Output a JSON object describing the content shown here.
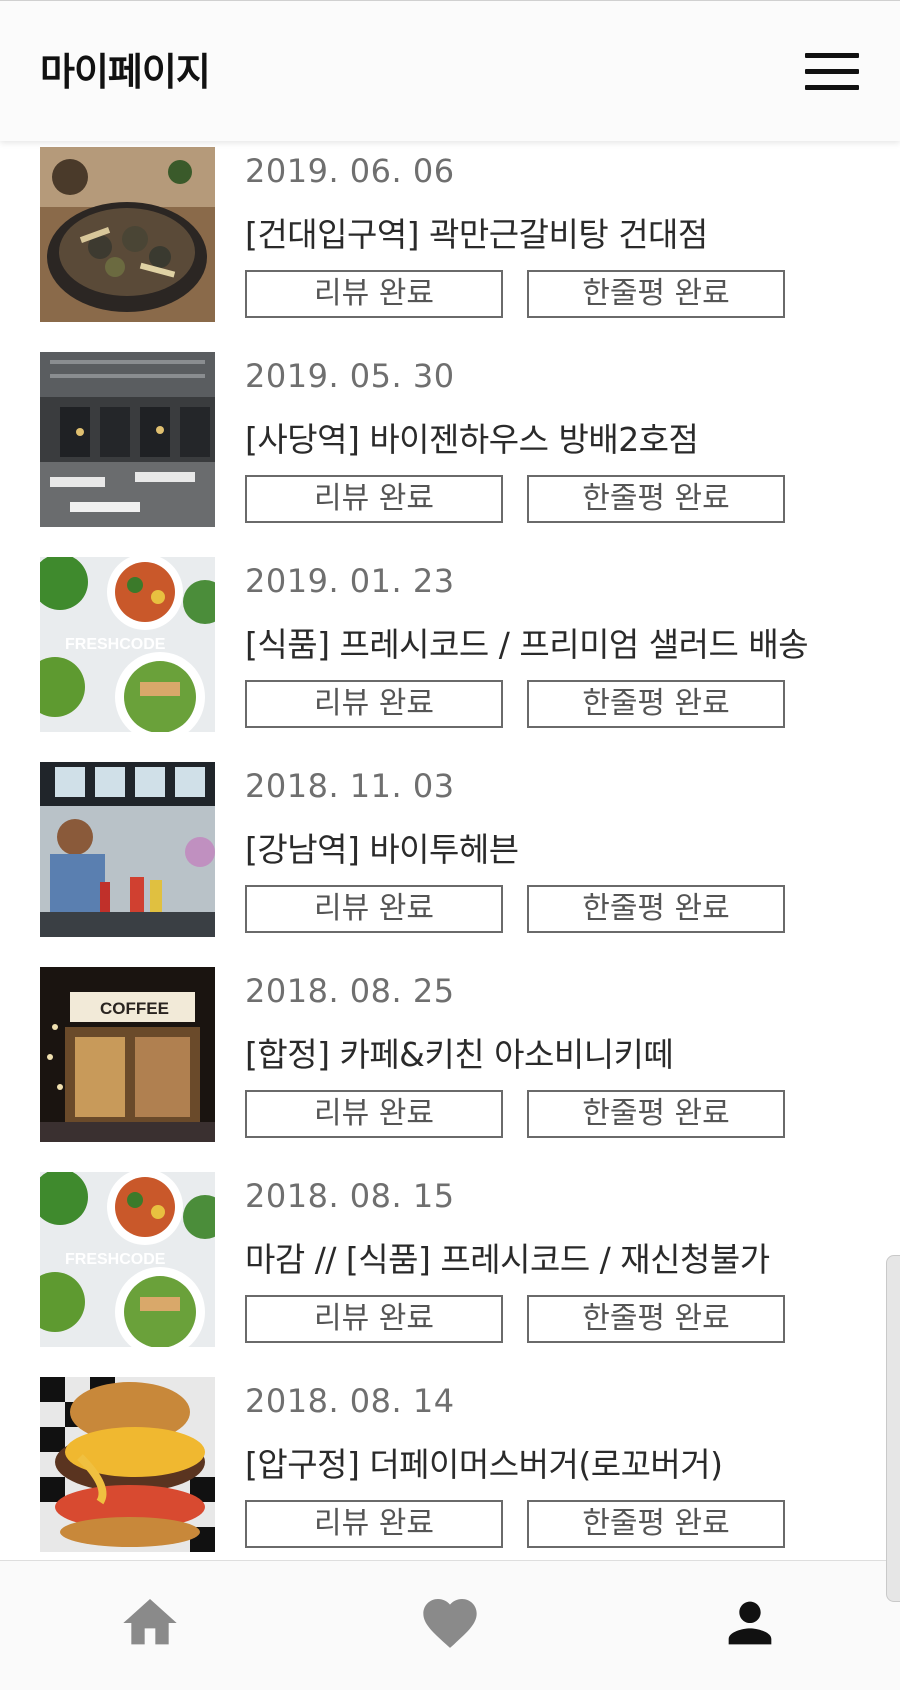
{
  "header": {
    "title": "마이페이지",
    "menu_icon": "hamburger-menu-icon"
  },
  "items": [
    {
      "date": "2019. 06. 06",
      "name": "[건대입구역] 곽만근갈비탕 건대점",
      "review_label": "리뷰 완료",
      "oneline_label": "한줄평 완료",
      "thumb": "food-galbi"
    },
    {
      "date": "2019. 05. 30",
      "name": "[사당역] 바이젠하우스 방배2호점",
      "review_label": "리뷰 완료",
      "oneline_label": "한줄평 완료",
      "thumb": "restaurant-interior"
    },
    {
      "date": "2019. 01. 23",
      "name": "[식품] 프레시코드 / 프리미엄 샐러드 배송",
      "review_label": "리뷰 완료",
      "oneline_label": "한줄평 완료",
      "thumb": "salad-freshcode",
      "thumb_text": "FRESHCODE"
    },
    {
      "date": "2018. 11. 03",
      "name": "[강남역] 바이투헤븐",
      "review_label": "리뷰 완료",
      "oneline_label": "한줄평 완료",
      "thumb": "mural-cafe"
    },
    {
      "date": "2018. 08. 25",
      "name": "[합정] 카페&키친 아소비니키떼",
      "review_label": "리뷰 완료",
      "oneline_label": "한줄평 완료",
      "thumb": "coffee-shop",
      "thumb_text": "COFFEE"
    },
    {
      "date": "2018. 08. 15",
      "name": "마감 // [식품] 프레시코드 / 재신청불가",
      "review_label": "리뷰 완료",
      "oneline_label": "한줄평 완료",
      "thumb": "salad-freshcode",
      "thumb_text": "FRESHCODE"
    },
    {
      "date": "2018. 08. 14",
      "name": "[압구정] 더페이머스버거(로꼬버거)",
      "review_label": "리뷰 완료",
      "oneline_label": "한줄평 완료",
      "thumb": "burger"
    }
  ],
  "bottom_nav": {
    "items": [
      {
        "icon": "home-icon",
        "color": "#8a8a8a"
      },
      {
        "icon": "heart-icon",
        "color": "#8a8a8a"
      },
      {
        "icon": "user-icon",
        "color": "#111111",
        "active": true
      }
    ]
  }
}
